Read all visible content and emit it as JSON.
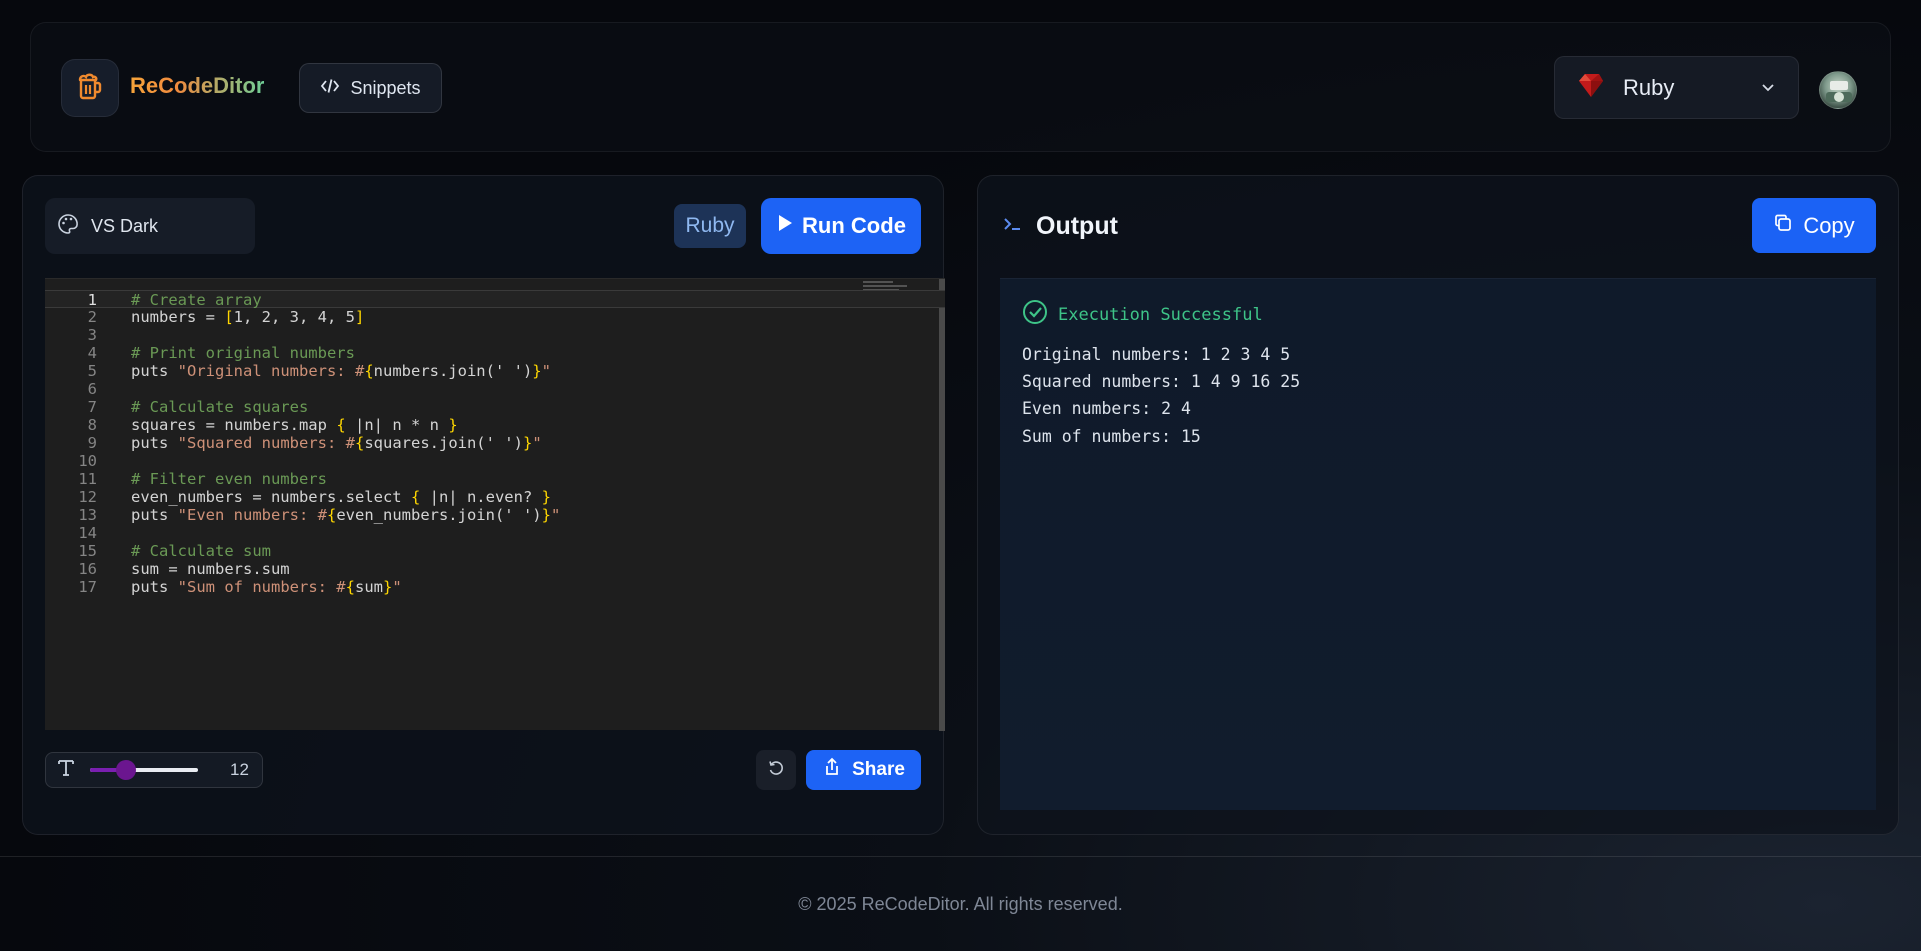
{
  "brand": {
    "name": "ReCodeDitor"
  },
  "header": {
    "snippets_label": "Snippets",
    "language_selected": "Ruby"
  },
  "editor_panel": {
    "theme": "VS Dark",
    "language_badge": "Ruby",
    "run_label": "Run Code",
    "font_size": "12",
    "font_size_fraction": 0.33,
    "share_label": "Share",
    "code_lines": [
      "# Create array",
      "numbers = [1, 2, 3, 4, 5]",
      "",
      "# Print original numbers",
      "puts \"Original numbers: #{numbers.join(' ')}\"",
      "",
      "# Calculate squares",
      "squares = numbers.map { |n| n * n }",
      "puts \"Squared numbers: #{squares.join(' ')}\"",
      "",
      "# Filter even numbers",
      "even_numbers = numbers.select { |n| n.even? }",
      "puts \"Even numbers: #{even_numbers.join(' ')}\"",
      "",
      "# Calculate sum",
      "sum = numbers.sum",
      "puts \"Sum of numbers: #{sum}\""
    ],
    "line_numbers": [
      "1",
      "2",
      "3",
      "4",
      "5",
      "6",
      "7",
      "8",
      "9",
      "10",
      "11",
      "12",
      "13",
      "14",
      "15",
      "16",
      "17"
    ]
  },
  "output_panel": {
    "title": "Output",
    "copy_label": "Copy",
    "status": "Execution Successful",
    "lines": [
      "Original numbers: 1 2 3 4 5",
      "Squared numbers: 1 4 9 16 25",
      "Even numbers: 2 4",
      "Sum of numbers: 15"
    ]
  },
  "footer": {
    "text": "© 2025 ReCodeDitor. All rights reserved."
  },
  "colors": {
    "accent": "#1d63f5",
    "success": "#3ec488",
    "brand_orange": "#f6a43a",
    "brand_green": "#6fcf97"
  },
  "icons": [
    "beer-mug-icon",
    "code-icon",
    "ruby-gem-icon",
    "chevron-down-icon",
    "palette-icon",
    "play-icon",
    "text-size-icon",
    "reset-icon",
    "share-icon",
    "terminal-icon",
    "copy-icon",
    "check-circle-icon"
  ]
}
